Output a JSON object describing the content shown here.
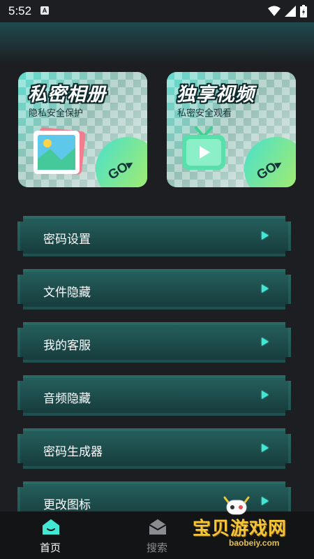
{
  "status_bar": {
    "time": "5:52",
    "notification_icon_letter": "A",
    "icons": [
      "wifi-icon",
      "cellular-signal-icon",
      "battery-icon"
    ]
  },
  "cards": [
    {
      "title": "私密相册",
      "subtitle": "隐私安全保护",
      "icon": "photo-album-icon",
      "go_label": "GO▸"
    },
    {
      "title": "独享视频",
      "subtitle": "私密安全观看",
      "icon": "tv-play-icon",
      "go_label": "GO▸"
    }
  ],
  "menu": [
    {
      "label": "密码设置"
    },
    {
      "label": "文件隐藏"
    },
    {
      "label": "我的客服"
    },
    {
      "label": "音频隐藏"
    },
    {
      "label": "密码生成器"
    },
    {
      "label": "更改图标"
    }
  ],
  "tabs": [
    {
      "label": "首页",
      "icon": "home-icon",
      "active": true
    },
    {
      "label": "搜索",
      "icon": "search-box-icon",
      "active": false
    }
  ],
  "watermark": {
    "text": "宝贝游戏网",
    "url": "baobeiy.com"
  },
  "colors": {
    "background": "#1c1e22",
    "accent": "#41e8d4",
    "menu_item": "#245e5b",
    "active_tab": "#ffffff",
    "inactive_tab": "#8a8c90"
  }
}
